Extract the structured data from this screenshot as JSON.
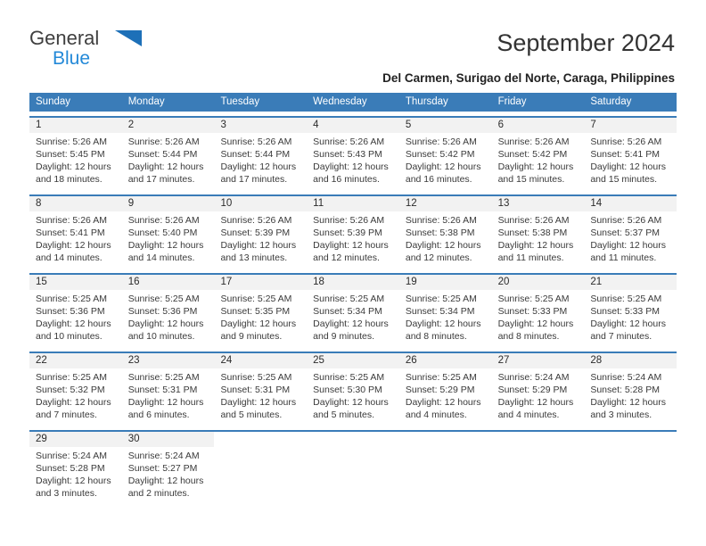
{
  "brand": {
    "name_top": "General",
    "name_bottom": "Blue",
    "triangle_color": "#1d70b8",
    "blue_text_color": "#2389d8"
  },
  "header": {
    "title": "September 2024",
    "subtitle": "Del Carmen, Surigao del Norte, Caraga, Philippines"
  },
  "colors": {
    "header_bg": "#3a7cb8",
    "header_text": "#ffffff",
    "datenum_bg": "#f2f2f2",
    "cell_text": "#3a3a3a"
  },
  "weekday_headers": [
    "Sunday",
    "Monday",
    "Tuesday",
    "Wednesday",
    "Thursday",
    "Friday",
    "Saturday"
  ],
  "weeks": [
    [
      {
        "day": "1",
        "sunrise": "Sunrise: 5:26 AM",
        "sunset": "Sunset: 5:45 PM",
        "daylight_1": "Daylight: 12 hours",
        "daylight_2": "and 18 minutes."
      },
      {
        "day": "2",
        "sunrise": "Sunrise: 5:26 AM",
        "sunset": "Sunset: 5:44 PM",
        "daylight_1": "Daylight: 12 hours",
        "daylight_2": "and 17 minutes."
      },
      {
        "day": "3",
        "sunrise": "Sunrise: 5:26 AM",
        "sunset": "Sunset: 5:44 PM",
        "daylight_1": "Daylight: 12 hours",
        "daylight_2": "and 17 minutes."
      },
      {
        "day": "4",
        "sunrise": "Sunrise: 5:26 AM",
        "sunset": "Sunset: 5:43 PM",
        "daylight_1": "Daylight: 12 hours",
        "daylight_2": "and 16 minutes."
      },
      {
        "day": "5",
        "sunrise": "Sunrise: 5:26 AM",
        "sunset": "Sunset: 5:42 PM",
        "daylight_1": "Daylight: 12 hours",
        "daylight_2": "and 16 minutes."
      },
      {
        "day": "6",
        "sunrise": "Sunrise: 5:26 AM",
        "sunset": "Sunset: 5:42 PM",
        "daylight_1": "Daylight: 12 hours",
        "daylight_2": "and 15 minutes."
      },
      {
        "day": "7",
        "sunrise": "Sunrise: 5:26 AM",
        "sunset": "Sunset: 5:41 PM",
        "daylight_1": "Daylight: 12 hours",
        "daylight_2": "and 15 minutes."
      }
    ],
    [
      {
        "day": "8",
        "sunrise": "Sunrise: 5:26 AM",
        "sunset": "Sunset: 5:41 PM",
        "daylight_1": "Daylight: 12 hours",
        "daylight_2": "and 14 minutes."
      },
      {
        "day": "9",
        "sunrise": "Sunrise: 5:26 AM",
        "sunset": "Sunset: 5:40 PM",
        "daylight_1": "Daylight: 12 hours",
        "daylight_2": "and 14 minutes."
      },
      {
        "day": "10",
        "sunrise": "Sunrise: 5:26 AM",
        "sunset": "Sunset: 5:39 PM",
        "daylight_1": "Daylight: 12 hours",
        "daylight_2": "and 13 minutes."
      },
      {
        "day": "11",
        "sunrise": "Sunrise: 5:26 AM",
        "sunset": "Sunset: 5:39 PM",
        "daylight_1": "Daylight: 12 hours",
        "daylight_2": "and 12 minutes."
      },
      {
        "day": "12",
        "sunrise": "Sunrise: 5:26 AM",
        "sunset": "Sunset: 5:38 PM",
        "daylight_1": "Daylight: 12 hours",
        "daylight_2": "and 12 minutes."
      },
      {
        "day": "13",
        "sunrise": "Sunrise: 5:26 AM",
        "sunset": "Sunset: 5:38 PM",
        "daylight_1": "Daylight: 12 hours",
        "daylight_2": "and 11 minutes."
      },
      {
        "day": "14",
        "sunrise": "Sunrise: 5:26 AM",
        "sunset": "Sunset: 5:37 PM",
        "daylight_1": "Daylight: 12 hours",
        "daylight_2": "and 11 minutes."
      }
    ],
    [
      {
        "day": "15",
        "sunrise": "Sunrise: 5:25 AM",
        "sunset": "Sunset: 5:36 PM",
        "daylight_1": "Daylight: 12 hours",
        "daylight_2": "and 10 minutes."
      },
      {
        "day": "16",
        "sunrise": "Sunrise: 5:25 AM",
        "sunset": "Sunset: 5:36 PM",
        "daylight_1": "Daylight: 12 hours",
        "daylight_2": "and 10 minutes."
      },
      {
        "day": "17",
        "sunrise": "Sunrise: 5:25 AM",
        "sunset": "Sunset: 5:35 PM",
        "daylight_1": "Daylight: 12 hours",
        "daylight_2": "and 9 minutes."
      },
      {
        "day": "18",
        "sunrise": "Sunrise: 5:25 AM",
        "sunset": "Sunset: 5:34 PM",
        "daylight_1": "Daylight: 12 hours",
        "daylight_2": "and 9 minutes."
      },
      {
        "day": "19",
        "sunrise": "Sunrise: 5:25 AM",
        "sunset": "Sunset: 5:34 PM",
        "daylight_1": "Daylight: 12 hours",
        "daylight_2": "and 8 minutes."
      },
      {
        "day": "20",
        "sunrise": "Sunrise: 5:25 AM",
        "sunset": "Sunset: 5:33 PM",
        "daylight_1": "Daylight: 12 hours",
        "daylight_2": "and 8 minutes."
      },
      {
        "day": "21",
        "sunrise": "Sunrise: 5:25 AM",
        "sunset": "Sunset: 5:33 PM",
        "daylight_1": "Daylight: 12 hours",
        "daylight_2": "and 7 minutes."
      }
    ],
    [
      {
        "day": "22",
        "sunrise": "Sunrise: 5:25 AM",
        "sunset": "Sunset: 5:32 PM",
        "daylight_1": "Daylight: 12 hours",
        "daylight_2": "and 7 minutes."
      },
      {
        "day": "23",
        "sunrise": "Sunrise: 5:25 AM",
        "sunset": "Sunset: 5:31 PM",
        "daylight_1": "Daylight: 12 hours",
        "daylight_2": "and 6 minutes."
      },
      {
        "day": "24",
        "sunrise": "Sunrise: 5:25 AM",
        "sunset": "Sunset: 5:31 PM",
        "daylight_1": "Daylight: 12 hours",
        "daylight_2": "and 5 minutes."
      },
      {
        "day": "25",
        "sunrise": "Sunrise: 5:25 AM",
        "sunset": "Sunset: 5:30 PM",
        "daylight_1": "Daylight: 12 hours",
        "daylight_2": "and 5 minutes."
      },
      {
        "day": "26",
        "sunrise": "Sunrise: 5:25 AM",
        "sunset": "Sunset: 5:29 PM",
        "daylight_1": "Daylight: 12 hours",
        "daylight_2": "and 4 minutes."
      },
      {
        "day": "27",
        "sunrise": "Sunrise: 5:24 AM",
        "sunset": "Sunset: 5:29 PM",
        "daylight_1": "Daylight: 12 hours",
        "daylight_2": "and 4 minutes."
      },
      {
        "day": "28",
        "sunrise": "Sunrise: 5:24 AM",
        "sunset": "Sunset: 5:28 PM",
        "daylight_1": "Daylight: 12 hours",
        "daylight_2": "and 3 minutes."
      }
    ],
    [
      {
        "day": "29",
        "sunrise": "Sunrise: 5:24 AM",
        "sunset": "Sunset: 5:28 PM",
        "daylight_1": "Daylight: 12 hours",
        "daylight_2": "and 3 minutes."
      },
      {
        "day": "30",
        "sunrise": "Sunrise: 5:24 AM",
        "sunset": "Sunset: 5:27 PM",
        "daylight_1": "Daylight: 12 hours",
        "daylight_2": "and 2 minutes."
      },
      {
        "day": "",
        "sunrise": "",
        "sunset": "",
        "daylight_1": "",
        "daylight_2": ""
      },
      {
        "day": "",
        "sunrise": "",
        "sunset": "",
        "daylight_1": "",
        "daylight_2": ""
      },
      {
        "day": "",
        "sunrise": "",
        "sunset": "",
        "daylight_1": "",
        "daylight_2": ""
      },
      {
        "day": "",
        "sunrise": "",
        "sunset": "",
        "daylight_1": "",
        "daylight_2": ""
      },
      {
        "day": "",
        "sunrise": "",
        "sunset": "",
        "daylight_1": "",
        "daylight_2": ""
      }
    ]
  ]
}
